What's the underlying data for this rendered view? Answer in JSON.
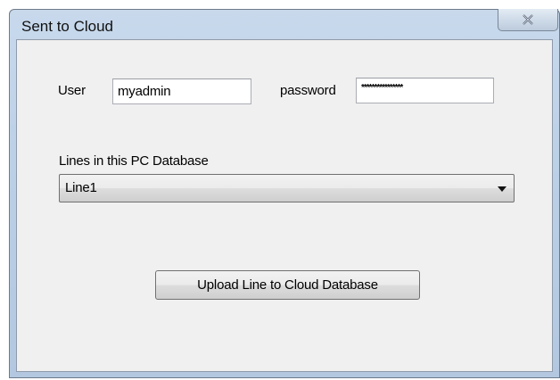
{
  "window": {
    "title": "Sent to Cloud",
    "close_icon": "close-x-icon"
  },
  "form": {
    "user_label": "User",
    "user_value": "myadmin",
    "password_label": "password",
    "password_value": "****************",
    "lines_label": "Lines in this PC Database",
    "lines_selected": "Line1",
    "dropdown_icon": "chevron-down-icon",
    "upload_label": "Upload Line to Cloud Database"
  }
}
